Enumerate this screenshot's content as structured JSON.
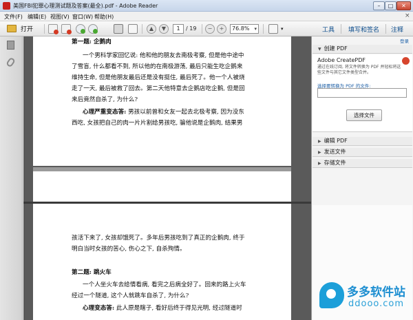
{
  "window": {
    "title": "美国FBI犯罪心理测试题及答案(最全).pdf - Adobe Reader",
    "controls": {
      "minimize": "–",
      "maximize": "□",
      "close": "✕"
    }
  },
  "menu": {
    "items": [
      "文件(F)",
      "编辑(E)",
      "视图(V)",
      "窗口(W)",
      "帮助(H)"
    ],
    "close_doc": "×"
  },
  "toolbar": {
    "open_label": "打开",
    "page_current": "1",
    "page_total": "/ 19",
    "zoom": "76.8%",
    "zoom_caret": "▾",
    "prev_page": "▲",
    "next_page": "▼",
    "zoom_out": "−",
    "zoom_in": "+",
    "tools_label": "工具",
    "sign_label": "填写和签名",
    "comment_label": "注释"
  },
  "icons": {
    "open": "folder-icon",
    "create_pdf": "create-pdf-icon",
    "combine": "combine-pdf-icon",
    "upload": "upload-icon",
    "cloud": "cloud-icon",
    "print": "printer-icon",
    "email": "email-icon",
    "pages": "pages-icon",
    "attachments": "paperclip-icon"
  },
  "document": {
    "page1": {
      "heading": "第一题: 企鹅肉",
      "lines": [
        "一个男科学家回忆说: 他和他的朋友去南极考察, 但是他中途中",
        "了雪盲, 什么都看不到, 所以他的在南极游荡, 最后只能生吃企鹅来",
        "维持生命, 但是他朋友最后还是没有挺住, 最后死了。他一个人被烧",
        "走了一天, 最后被救了回去。第二天他特意去企鹅店吃企鹅, 但是回",
        "来后竟然自杀了, 为什么?"
      ],
      "answer_label": "心理严重变态答:",
      "answer_lines": [
        "男孩以前曾和女友一起去北极考察, 因为没东",
        "西吃, 女孩把自己的肉一片片割给男孩吃, 骗他说是企鹅肉, 结果男"
      ]
    },
    "page3": {
      "lines": [
        "孩活下来了, 女孩却饿死了。多年后男孩吃到了真正的企鹅肉, 终于",
        "明白当时女孩的苦心, 伤心之下, 自杀殉情。"
      ],
      "heading2": "第二题: 跳火车",
      "q2_lines": [
        "一个人坐火车去给情看病, 看完之后病全好了。回来的路上火车",
        "经过一个隧道, 这个人就跳车自杀了, 为什么?"
      ],
      "answer2_label": "心理变态答:",
      "answer2_text": "此人原是瞎子, 看好后终于得见光明, 经过隧道时"
    }
  },
  "right_panel": {
    "login": "登录",
    "create_pdf_section": "创建 PDF",
    "createpdf_title": "Adobe CreatePDF",
    "createpdf_desc": "通过在线订阅, 将文件转换为 PDF 并轻松将这些文件与其它文件类型合并。",
    "convert_label": "选择要转换为 PDF 的文件:",
    "select_button": "选择文件",
    "sections": [
      "编辑 PDF",
      "发送文件",
      "存储文件"
    ]
  },
  "watermark": {
    "cn": "多多软件站",
    "en": "ddooo.com"
  }
}
